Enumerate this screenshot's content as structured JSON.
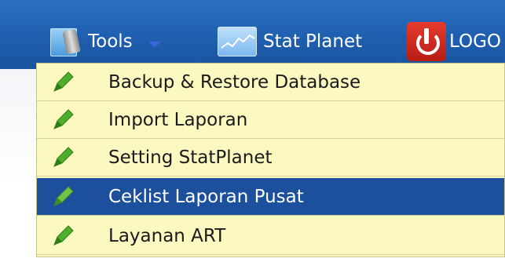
{
  "nav": {
    "tools_label": "Tools",
    "stat_label": "Stat Planet",
    "logout_label": "LOGO"
  },
  "menu": {
    "items": [
      {
        "label": "Backup & Restore Database"
      },
      {
        "label": "Import Laporan"
      },
      {
        "label": "Setting StatPlanet"
      },
      {
        "label": "Ceklist Laporan Pusat",
        "active": true
      },
      {
        "label": "Layanan ART"
      }
    ]
  },
  "colors": {
    "nav_bg": "#1f5fae",
    "menu_bg": "#fcf9c0",
    "active_bg": "#1c4f9c",
    "icon_green": "#4fae2c"
  },
  "icons": {
    "tools": "tools-icon",
    "stat": "chart-icon",
    "logout": "power-icon",
    "menu_item": "pencil-icon"
  }
}
